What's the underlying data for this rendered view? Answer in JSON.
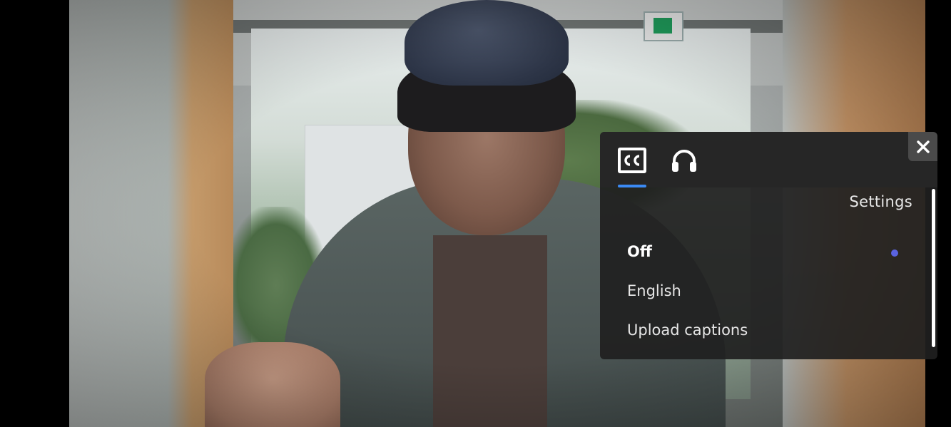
{
  "captions_panel": {
    "tabs": [
      {
        "icon": "closed-captions-icon",
        "active": true
      },
      {
        "icon": "headphones-icon",
        "active": false
      }
    ],
    "close_icon": "close-icon",
    "settings_label": "Settings",
    "options": [
      {
        "label": "Off",
        "selected": true
      },
      {
        "label": "English",
        "selected": false
      },
      {
        "label": "Upload captions",
        "selected": false
      }
    ],
    "colors": {
      "panel_background": "#202020",
      "active_tab_indicator": "#3b8af5",
      "selected_dot": "#5a63e0",
      "text": "#e6e6e6"
    }
  }
}
